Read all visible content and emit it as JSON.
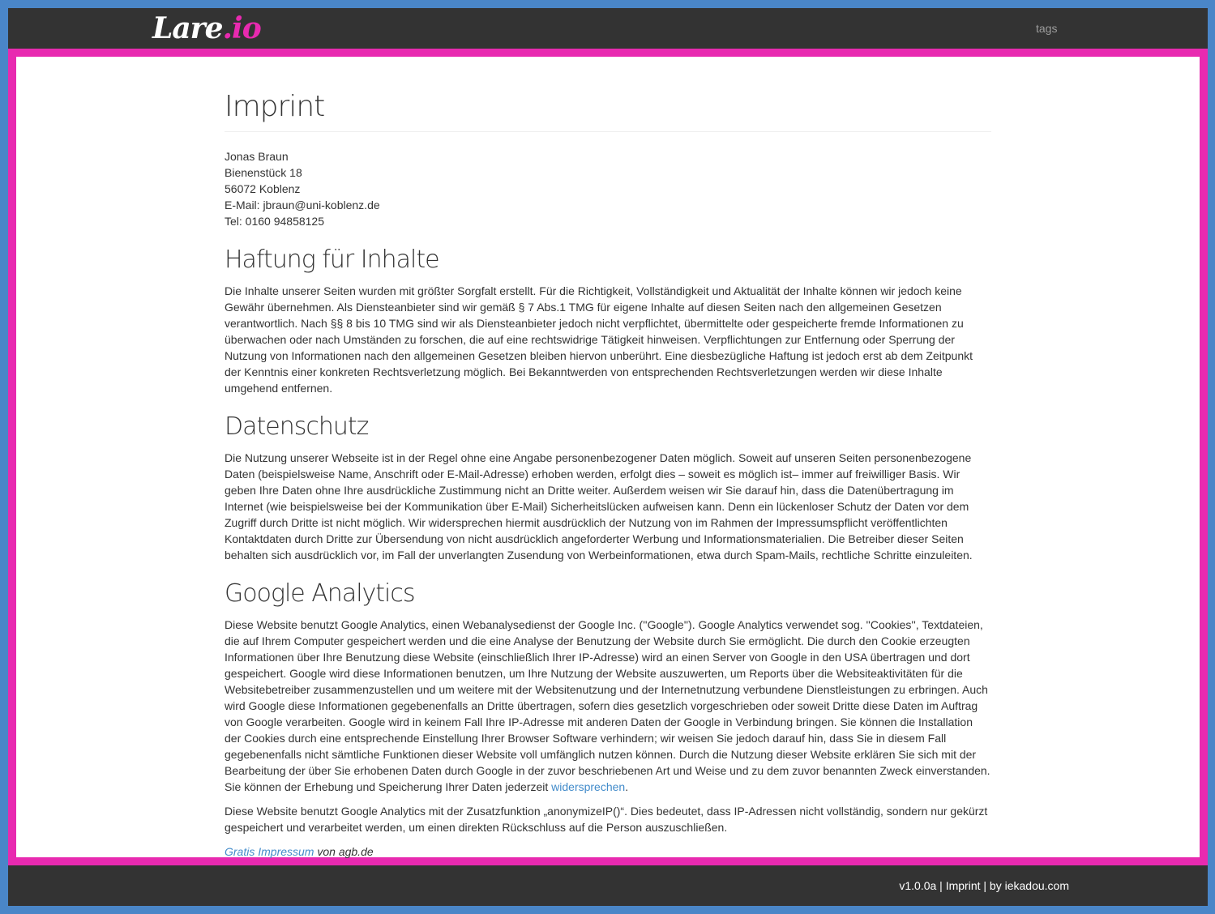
{
  "navbar": {
    "logo_main": "Lare",
    "logo_accent": ".io",
    "tags_link": "tags"
  },
  "page": {
    "title": "Imprint",
    "address": [
      "Jonas Braun",
      "Bienenstück 18",
      "56072 Koblenz",
      "E-Mail: jbraun@uni-koblenz.de",
      "Tel: 0160 94858125"
    ],
    "sections": {
      "haftung": {
        "heading": "Haftung für Inhalte",
        "text": "Die Inhalte unserer Seiten wurden mit größter Sorgfalt erstellt. Für die Richtigkeit, Vollständigkeit und Aktualität der Inhalte können wir jedoch keine Gewähr übernehmen. Als Diensteanbieter sind wir gemäß § 7 Abs.1 TMG für eigene Inhalte auf diesen Seiten nach den allgemeinen Gesetzen verantwortlich. Nach §§ 8 bis 10 TMG sind wir als Diensteanbieter jedoch nicht verpflichtet, übermittelte oder gespeicherte fremde Informationen zu überwachen oder nach Umständen zu forschen, die auf eine rechtswidrige Tätigkeit hinweisen. Verpflichtungen zur Entfernung oder Sperrung der Nutzung von Informationen nach den allgemeinen Gesetzen bleiben hiervon unberührt. Eine diesbezügliche Haftung ist jedoch erst ab dem Zeitpunkt der Kenntnis einer konkreten Rechtsverletzung möglich. Bei Bekanntwerden von entsprechenden Rechtsverletzungen werden wir diese Inhalte umgehend entfernen."
      },
      "datenschutz": {
        "heading": "Datenschutz",
        "text": "Die Nutzung unserer Webseite ist in der Regel ohne eine Angabe personenbezogener Daten möglich. Soweit auf unseren Seiten personenbezogene Daten (beispielsweise Name, Anschrift oder E-Mail-Adresse) erhoben werden, erfolgt dies – soweit es möglich ist– immer auf freiwilliger Basis. Wir geben Ihre Daten ohne Ihre ausdrückliche Zustimmung nicht an Dritte weiter. Außerdem weisen wir Sie darauf hin, dass die Datenübertragung im Internet (wie beispielsweise bei der Kommunikation über E-Mail) Sicherheitslücken aufweisen kann. Denn ein lückenloser Schutz der Daten vor dem Zugriff durch Dritte ist nicht möglich. Wir widersprechen hiermit ausdrücklich der Nutzung von im Rahmen der Impressumspflicht veröffentlichten Kontaktdaten durch Dritte zur Übersendung von nicht ausdrücklich angeforderter Werbung und Informationsmaterialien. Die Betreiber dieser Seiten behalten sich ausdrücklich vor, im Fall der unverlangten Zusendung von Werbeinformationen, etwa durch Spam-Mails, rechtliche Schritte einzuleiten."
      },
      "analytics": {
        "heading": "Google Analytics",
        "text1": "Diese Website benutzt Google Analytics, einen Webanalysedienst der Google Inc. (''Google''). Google Analytics verwendet sog. ''Cookies'', Textdateien, die auf Ihrem Computer gespeichert werden und die eine Analyse der Benutzung der Website durch Sie ermöglicht. Die durch den Cookie erzeugten Informationen über Ihre Benutzung diese Website (einschließlich Ihrer IP-Adresse) wird an einen Server von Google in den USA übertragen und dort gespeichert. Google wird diese Informationen benutzen, um Ihre Nutzung der Website auszuwerten, um Reports über die Websiteaktivitäten für die Websitebetreiber zusammenzustellen und um weitere mit der Websitenutzung und der Internetnutzung verbundene Dienstleistungen zu erbringen. Auch wird Google diese Informationen gegebenenfalls an Dritte übertragen, sofern dies gesetzlich vorgeschrieben oder soweit Dritte diese Daten im Auftrag von Google verarbeiten. Google wird in keinem Fall Ihre IP-Adresse mit anderen Daten der Google in Verbindung bringen. Sie können die Installation der Cookies durch eine entsprechende Einstellung Ihrer Browser Software verhindern; wir weisen Sie jedoch darauf hin, dass Sie in diesem Fall gegebenenfalls nicht sämtliche Funktionen dieser Website voll umfänglich nutzen können. Durch die Nutzung dieser Website erklären Sie sich mit der Bearbeitung der über Sie erhobenen Daten durch Google in der zuvor beschriebenen Art und Weise und zu dem zuvor benannten Zweck einverstanden. Sie können der Erhebung und Speicherung Ihrer Daten jederzeit ",
        "link": "widersprechen",
        "text1_end": ".",
        "text2": "Diese Website benutzt Google Analytics mit der Zusatzfunktion „anonymizeIP()“. Dies bedeutet, dass IP-Adressen nicht vollständig, sondern nur gekürzt gespeichert und verarbeitet werden, um einen direkten Rückschluss auf die Person auszuschließen."
      }
    },
    "credit": {
      "link": "Gratis Impressum",
      "suffix": " von agb.de"
    }
  },
  "footer": {
    "version": "v1.0.0a",
    "sep1": " | ",
    "imprint": "Imprint",
    "sep2": " | by ",
    "author": "iekadou.com"
  },
  "colors": {
    "outer_border": "#4a86c8",
    "accent_pink": "#e82ab0",
    "navbar_bg": "#333333",
    "link": "#428bca"
  }
}
